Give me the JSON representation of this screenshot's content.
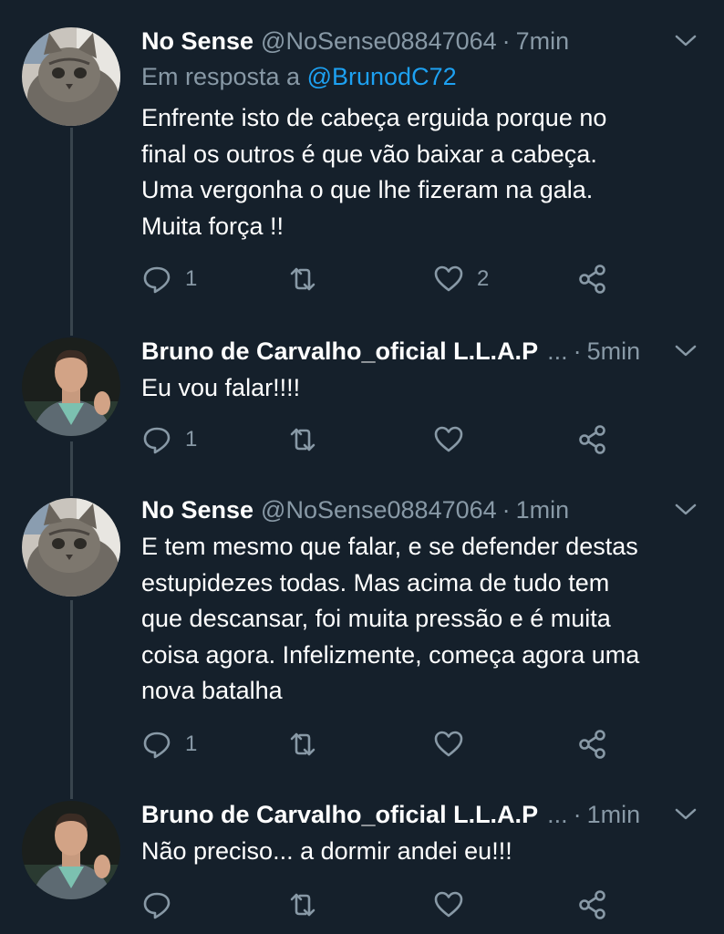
{
  "colors": {
    "background": "#15202b",
    "text": "#ffffff",
    "secondary": "#8899a6",
    "link": "#1da1f2",
    "thread_line": "#38444d"
  },
  "tweets": [
    {
      "name": "No Sense",
      "handle": "@NoSense08847064",
      "separator": "·",
      "time": "7min",
      "reply_prefix": "Em resposta a",
      "reply_mention": "@BrunodC72",
      "lines": [
        "Enfrente isto de cabeça erguida porque no",
        "final os outros é que vão baixar a cabeça.",
        "Uma vergonha o que lhe fizeram na gala.",
        "Muita força !!"
      ],
      "reply_count": "1",
      "like_count": "2",
      "avatar": "cat-avatar"
    },
    {
      "name": "Bruno de Carvalho_oficial L.L.A.P",
      "ellipsis": "...",
      "separator": "·",
      "time": "5min",
      "lines": [
        "Eu vou falar!!!!"
      ],
      "reply_count": "1",
      "like_count": "",
      "avatar": "man-avatar"
    },
    {
      "name": "No Sense",
      "handle": "@NoSense08847064",
      "separator": "·",
      "time": "1min",
      "lines": [
        "E tem mesmo que falar, e se defender destas",
        "estupidezes todas. Mas acima de tudo tem",
        "que descansar, foi muita pressão e é muita",
        "coisa agora. Infelizmente, começa agora uma",
        "nova batalha"
      ],
      "reply_count": "1",
      "like_count": "",
      "avatar": "cat-avatar"
    },
    {
      "name": "Bruno de Carvalho_oficial L.L.A.P",
      "ellipsis": "...",
      "separator": "·",
      "time": "1min",
      "lines": [
        "Não preciso... a dormir andei eu!!!"
      ],
      "reply_count": "",
      "like_count": "",
      "avatar": "man-avatar"
    }
  ]
}
